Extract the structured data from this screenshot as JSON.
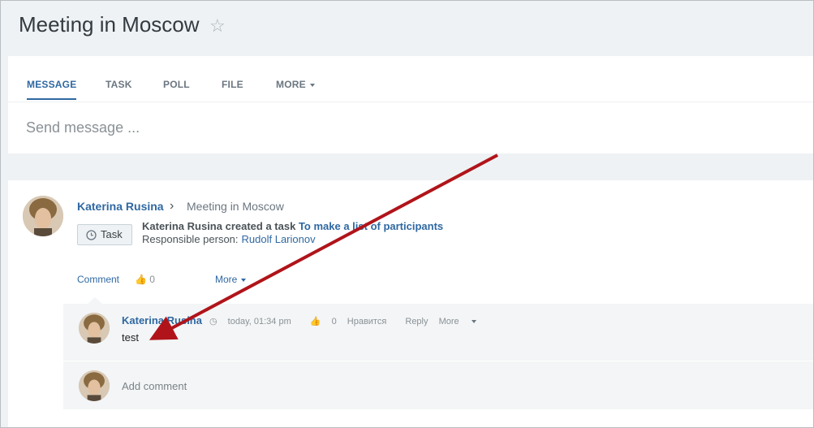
{
  "header": {
    "title": "Meeting in Moscow",
    "star_icon": "star-outline-icon"
  },
  "composer": {
    "tabs": [
      {
        "label": "MESSAGE",
        "active": true
      },
      {
        "label": "TASK",
        "active": false
      },
      {
        "label": "POLL",
        "active": false
      },
      {
        "label": "FILE",
        "active": false
      },
      {
        "label": "MORE",
        "active": false
      }
    ],
    "placeholder": "Send message ..."
  },
  "post": {
    "author": "Katerina Rusina",
    "destination": "Meeting in Moscow",
    "badge_label": "Task",
    "line1_prefix": "Katerina Rusina created a task",
    "task_link": "To make a list of participants",
    "responsible_label": "Responsible person:",
    "responsible_name": "Rudolf Larionov",
    "actions": {
      "comment": "Comment",
      "likes": "0",
      "more": "More"
    }
  },
  "comment": {
    "author": "Katerina Rusina",
    "time": "today, 01:34 pm",
    "likes": "0",
    "like_label": "Нравится",
    "reply": "Reply",
    "more": "More",
    "text": "test"
  },
  "add_comment": {
    "placeholder": "Add comment"
  },
  "colors": {
    "accent": "#2f68a2",
    "annotation_arrow": "#b0141a"
  }
}
